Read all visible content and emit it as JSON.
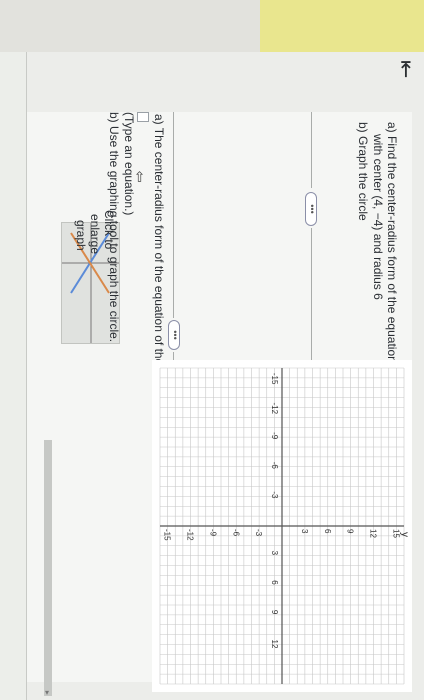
{
  "question": {
    "part_a": "a) Find the center-radius form of the equation of the circle",
    "part_a_cont": "with center (4, −4) and radius 6",
    "part_b": "b) Graph the circle"
  },
  "answer": {
    "a_prompt": "a) The center-radius form of the equation of the circle is",
    "hint": "(Type an equation.)",
    "b_prompt": "b) Use the graphing tool to graph the circle."
  },
  "thumbnail": {
    "line1": "Click to",
    "line2": "enlarge",
    "line3": "graph"
  },
  "more_button": "•••",
  "icons": {
    "back": "collapse-arrow-icon",
    "scroll_up": "triangle-up-icon",
    "scroll_down": "triangle-down-icon",
    "cursor": "pointer-cursor-icon"
  },
  "graph": {
    "y_axis_label": "y",
    "x_ticks": [
      "-15",
      "-12",
      "-9",
      "-6",
      "-3",
      "3",
      "6",
      "9",
      "12"
    ],
    "y_ticks": [
      "15",
      "12",
      "9",
      "6",
      "3",
      "-3",
      "-6",
      "-9",
      "-12",
      "-15"
    ],
    "xlim": [
      -16,
      16
    ],
    "ylim": [
      -16,
      16
    ],
    "grid": true
  },
  "colors": {
    "grid": "#c7c7c7",
    "axis": "#555555",
    "panel": "#f5f6f4",
    "accent_yellow": "#e9e68e"
  }
}
